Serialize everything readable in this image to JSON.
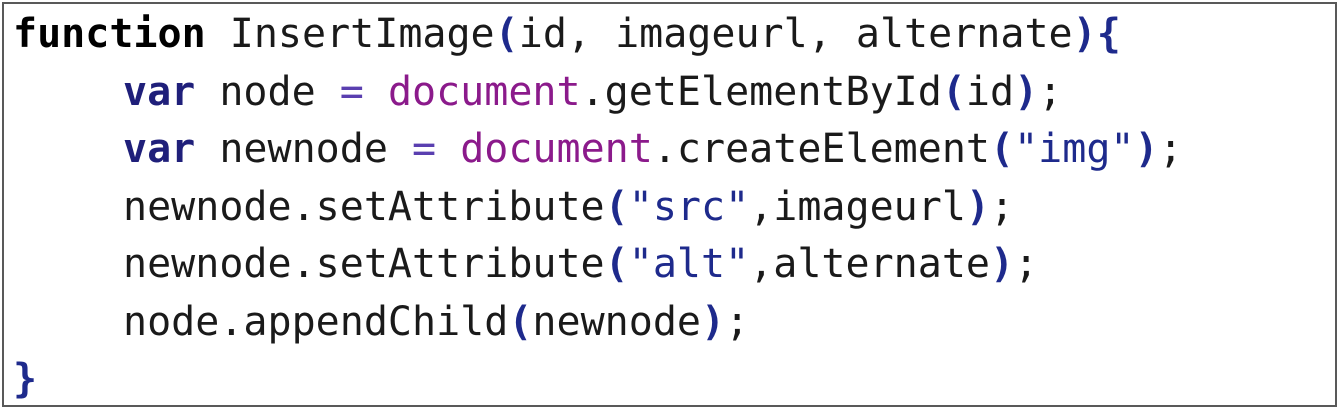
{
  "colors": {
    "text": "#1a1a1a",
    "keyword": "#000000",
    "var_keyword": "#1f1f7a",
    "builtin_object": "#8b1a8b",
    "paren": "#1e2a8c",
    "string": "#1e2a8c",
    "operator": "#5a3fb0",
    "border": "#595959"
  },
  "code": {
    "lines": [
      {
        "tokens": [
          {
            "type": "keyword",
            "text": "function"
          },
          {
            "type": "plain",
            "text": " InsertImage"
          },
          {
            "type": "paren",
            "text": "("
          },
          {
            "type": "plain",
            "text": "id, imageurl, alternate"
          },
          {
            "type": "paren",
            "text": ")"
          },
          {
            "type": "brace",
            "text": "{"
          }
        ]
      },
      {
        "indent": 1,
        "tokens": [
          {
            "type": "var",
            "text": "var"
          },
          {
            "type": "plain",
            "text": " node "
          },
          {
            "type": "operator",
            "text": "="
          },
          {
            "type": "plain",
            "text": " "
          },
          {
            "type": "builtin",
            "text": "document"
          },
          {
            "type": "plain",
            "text": ".getElementById"
          },
          {
            "type": "paren",
            "text": "("
          },
          {
            "type": "plain",
            "text": "id"
          },
          {
            "type": "paren",
            "text": ")"
          },
          {
            "type": "plain",
            "text": ";"
          }
        ]
      },
      {
        "indent": 1,
        "tokens": [
          {
            "type": "var",
            "text": "var"
          },
          {
            "type": "plain",
            "text": " newnode "
          },
          {
            "type": "operator",
            "text": "="
          },
          {
            "type": "plain",
            "text": " "
          },
          {
            "type": "builtin",
            "text": "document"
          },
          {
            "type": "plain",
            "text": ".createElement"
          },
          {
            "type": "paren",
            "text": "("
          },
          {
            "type": "string",
            "text": "\"img\""
          },
          {
            "type": "paren",
            "text": ")"
          },
          {
            "type": "plain",
            "text": ";"
          }
        ]
      },
      {
        "indent": 1,
        "tokens": [
          {
            "type": "plain",
            "text": "newnode.setAttribute"
          },
          {
            "type": "paren",
            "text": "("
          },
          {
            "type": "string",
            "text": "\"src\""
          },
          {
            "type": "plain",
            "text": ",imageurl"
          },
          {
            "type": "paren",
            "text": ")"
          },
          {
            "type": "plain",
            "text": ";"
          }
        ]
      },
      {
        "indent": 1,
        "tokens": [
          {
            "type": "plain",
            "text": "newnode.setAttribute"
          },
          {
            "type": "paren",
            "text": "("
          },
          {
            "type": "string",
            "text": "\"alt\""
          },
          {
            "type": "plain",
            "text": ",alternate"
          },
          {
            "type": "paren",
            "text": ")"
          },
          {
            "type": "plain",
            "text": ";"
          }
        ]
      },
      {
        "indent": 1,
        "tokens": [
          {
            "type": "plain",
            "text": "node.appendChild"
          },
          {
            "type": "paren",
            "text": "("
          },
          {
            "type": "plain",
            "text": "newnode"
          },
          {
            "type": "paren",
            "text": ")"
          },
          {
            "type": "plain",
            "text": ";"
          }
        ]
      },
      {
        "tokens": [
          {
            "type": "brace",
            "text": "}"
          }
        ]
      }
    ]
  }
}
